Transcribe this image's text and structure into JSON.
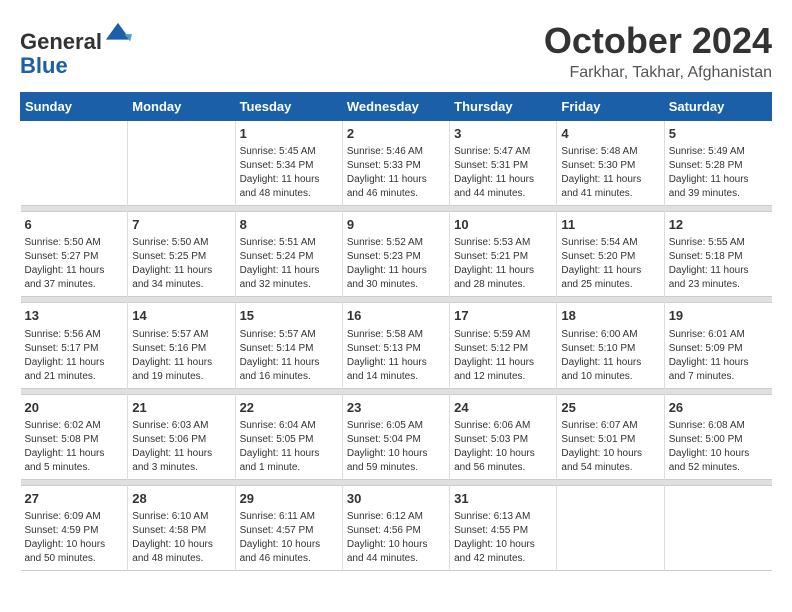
{
  "logo": {
    "general": "General",
    "blue": "Blue"
  },
  "title": "October 2024",
  "subtitle": "Farkhar, Takhar, Afghanistan",
  "headers": [
    "Sunday",
    "Monday",
    "Tuesday",
    "Wednesday",
    "Thursday",
    "Friday",
    "Saturday"
  ],
  "weeks": [
    {
      "days": [
        {
          "num": "",
          "lines": []
        },
        {
          "num": "",
          "lines": []
        },
        {
          "num": "1",
          "lines": [
            "Sunrise: 5:45 AM",
            "Sunset: 5:34 PM",
            "Daylight: 11 hours",
            "and 48 minutes."
          ]
        },
        {
          "num": "2",
          "lines": [
            "Sunrise: 5:46 AM",
            "Sunset: 5:33 PM",
            "Daylight: 11 hours",
            "and 46 minutes."
          ]
        },
        {
          "num": "3",
          "lines": [
            "Sunrise: 5:47 AM",
            "Sunset: 5:31 PM",
            "Daylight: 11 hours",
            "and 44 minutes."
          ]
        },
        {
          "num": "4",
          "lines": [
            "Sunrise: 5:48 AM",
            "Sunset: 5:30 PM",
            "Daylight: 11 hours",
            "and 41 minutes."
          ]
        },
        {
          "num": "5",
          "lines": [
            "Sunrise: 5:49 AM",
            "Sunset: 5:28 PM",
            "Daylight: 11 hours",
            "and 39 minutes."
          ]
        }
      ]
    },
    {
      "days": [
        {
          "num": "6",
          "lines": [
            "Sunrise: 5:50 AM",
            "Sunset: 5:27 PM",
            "Daylight: 11 hours",
            "and 37 minutes."
          ]
        },
        {
          "num": "7",
          "lines": [
            "Sunrise: 5:50 AM",
            "Sunset: 5:25 PM",
            "Daylight: 11 hours",
            "and 34 minutes."
          ]
        },
        {
          "num": "8",
          "lines": [
            "Sunrise: 5:51 AM",
            "Sunset: 5:24 PM",
            "Daylight: 11 hours",
            "and 32 minutes."
          ]
        },
        {
          "num": "9",
          "lines": [
            "Sunrise: 5:52 AM",
            "Sunset: 5:23 PM",
            "Daylight: 11 hours",
            "and 30 minutes."
          ]
        },
        {
          "num": "10",
          "lines": [
            "Sunrise: 5:53 AM",
            "Sunset: 5:21 PM",
            "Daylight: 11 hours",
            "and 28 minutes."
          ]
        },
        {
          "num": "11",
          "lines": [
            "Sunrise: 5:54 AM",
            "Sunset: 5:20 PM",
            "Daylight: 11 hours",
            "and 25 minutes."
          ]
        },
        {
          "num": "12",
          "lines": [
            "Sunrise: 5:55 AM",
            "Sunset: 5:18 PM",
            "Daylight: 11 hours",
            "and 23 minutes."
          ]
        }
      ]
    },
    {
      "days": [
        {
          "num": "13",
          "lines": [
            "Sunrise: 5:56 AM",
            "Sunset: 5:17 PM",
            "Daylight: 11 hours",
            "and 21 minutes."
          ]
        },
        {
          "num": "14",
          "lines": [
            "Sunrise: 5:57 AM",
            "Sunset: 5:16 PM",
            "Daylight: 11 hours",
            "and 19 minutes."
          ]
        },
        {
          "num": "15",
          "lines": [
            "Sunrise: 5:57 AM",
            "Sunset: 5:14 PM",
            "Daylight: 11 hours",
            "and 16 minutes."
          ]
        },
        {
          "num": "16",
          "lines": [
            "Sunrise: 5:58 AM",
            "Sunset: 5:13 PM",
            "Daylight: 11 hours",
            "and 14 minutes."
          ]
        },
        {
          "num": "17",
          "lines": [
            "Sunrise: 5:59 AM",
            "Sunset: 5:12 PM",
            "Daylight: 11 hours",
            "and 12 minutes."
          ]
        },
        {
          "num": "18",
          "lines": [
            "Sunrise: 6:00 AM",
            "Sunset: 5:10 PM",
            "Daylight: 11 hours",
            "and 10 minutes."
          ]
        },
        {
          "num": "19",
          "lines": [
            "Sunrise: 6:01 AM",
            "Sunset: 5:09 PM",
            "Daylight: 11 hours",
            "and 7 minutes."
          ]
        }
      ]
    },
    {
      "days": [
        {
          "num": "20",
          "lines": [
            "Sunrise: 6:02 AM",
            "Sunset: 5:08 PM",
            "Daylight: 11 hours",
            "and 5 minutes."
          ]
        },
        {
          "num": "21",
          "lines": [
            "Sunrise: 6:03 AM",
            "Sunset: 5:06 PM",
            "Daylight: 11 hours",
            "and 3 minutes."
          ]
        },
        {
          "num": "22",
          "lines": [
            "Sunrise: 6:04 AM",
            "Sunset: 5:05 PM",
            "Daylight: 11 hours",
            "and 1 minute."
          ]
        },
        {
          "num": "23",
          "lines": [
            "Sunrise: 6:05 AM",
            "Sunset: 5:04 PM",
            "Daylight: 10 hours",
            "and 59 minutes."
          ]
        },
        {
          "num": "24",
          "lines": [
            "Sunrise: 6:06 AM",
            "Sunset: 5:03 PM",
            "Daylight: 10 hours",
            "and 56 minutes."
          ]
        },
        {
          "num": "25",
          "lines": [
            "Sunrise: 6:07 AM",
            "Sunset: 5:01 PM",
            "Daylight: 10 hours",
            "and 54 minutes."
          ]
        },
        {
          "num": "26",
          "lines": [
            "Sunrise: 6:08 AM",
            "Sunset: 5:00 PM",
            "Daylight: 10 hours",
            "and 52 minutes."
          ]
        }
      ]
    },
    {
      "days": [
        {
          "num": "27",
          "lines": [
            "Sunrise: 6:09 AM",
            "Sunset: 4:59 PM",
            "Daylight: 10 hours",
            "and 50 minutes."
          ]
        },
        {
          "num": "28",
          "lines": [
            "Sunrise: 6:10 AM",
            "Sunset: 4:58 PM",
            "Daylight: 10 hours",
            "and 48 minutes."
          ]
        },
        {
          "num": "29",
          "lines": [
            "Sunrise: 6:11 AM",
            "Sunset: 4:57 PM",
            "Daylight: 10 hours",
            "and 46 minutes."
          ]
        },
        {
          "num": "30",
          "lines": [
            "Sunrise: 6:12 AM",
            "Sunset: 4:56 PM",
            "Daylight: 10 hours",
            "and 44 minutes."
          ]
        },
        {
          "num": "31",
          "lines": [
            "Sunrise: 6:13 AM",
            "Sunset: 4:55 PM",
            "Daylight: 10 hours",
            "and 42 minutes."
          ]
        },
        {
          "num": "",
          "lines": []
        },
        {
          "num": "",
          "lines": []
        }
      ]
    }
  ]
}
